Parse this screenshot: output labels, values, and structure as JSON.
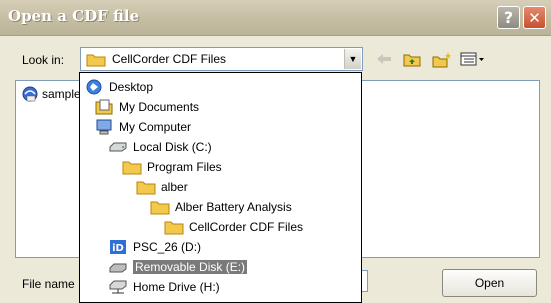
{
  "window": {
    "title": "Open a CDF file",
    "help_label": "?",
    "close_label": "✕"
  },
  "lookin": {
    "label": "Look in:",
    "value": "CellCorder CDF Files",
    "dropdown_arrow": "▼"
  },
  "toolbar": {
    "buttons": [
      {
        "name": "back-icon"
      },
      {
        "name": "up-folder-icon"
      },
      {
        "name": "new-folder-icon"
      },
      {
        "name": "view-menu-icon"
      }
    ]
  },
  "filelist": {
    "items": [
      {
        "label": "sample",
        "icon": "cdf-file-icon"
      }
    ]
  },
  "dropdown": {
    "items": [
      {
        "label": "Desktop",
        "icon": "desktop-icon",
        "level": 0
      },
      {
        "label": "My Documents",
        "icon": "documents-icon",
        "level": 1
      },
      {
        "label": "My Computer",
        "icon": "computer-icon",
        "level": 1
      },
      {
        "label": "Local Disk (C:)",
        "icon": "drive-icon",
        "level": 2
      },
      {
        "label": "Program Files",
        "icon": "folder-icon",
        "level": 3
      },
      {
        "label": "alber",
        "icon": "folder-icon",
        "level": 4
      },
      {
        "label": "Alber Battery Analysis",
        "icon": "folder-icon",
        "level": 5
      },
      {
        "label": "CellCorder CDF Files",
        "icon": "folder-icon",
        "level": 6
      },
      {
        "label": "PSC_26 (D:)",
        "icon": "psc-drive-icon",
        "level": 2
      },
      {
        "label": "Removable Disk (E:)",
        "icon": "removable-drive-icon",
        "level": 2,
        "selected": true
      },
      {
        "label": "Home Drive (H:)",
        "icon": "network-drive-icon",
        "level": 2
      }
    ]
  },
  "filename": {
    "label": "File name",
    "value": ""
  },
  "open_button": {
    "label": "Open"
  },
  "colors": {
    "title_text": "#ffffff",
    "folder": "#f2c94c",
    "selection": "#7a7a7a",
    "border": "#7f9db9"
  }
}
